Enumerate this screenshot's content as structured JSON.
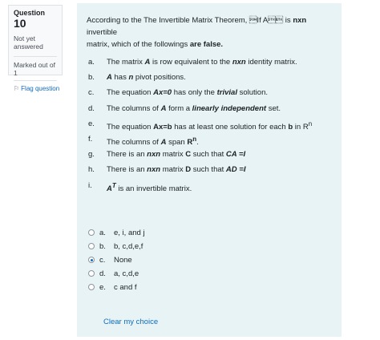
{
  "info": {
    "question_label": "Question",
    "question_number": "10",
    "state": "Not yet answered",
    "grade": "Marked out of 1",
    "flag_label": "Flag question",
    "flag_icon": "flag-icon"
  },
  "question": {
    "line1": "According to the The Invertible Matrix Theorem, If A is nxn invertible",
    "line2": "matrix, which of the followings are false."
  },
  "statements": [
    {
      "label": "a.",
      "text": "The matrix A is row equivalent to the nxn identity matrix."
    },
    {
      "label": "b.",
      "text": "A has n pivot positions."
    },
    {
      "label": "c.",
      "text": "The equation Ax=0 has only the trivial solution."
    },
    {
      "label": "d.",
      "text": "The columns of A form a linearly independent set."
    },
    {
      "label": "e.",
      "text": "The equation Ax=b has at least one solution for each b in Rⁿ"
    },
    {
      "label": "f.",
      "text": "The columns of A span Rⁿ."
    },
    {
      "label": "g.",
      "text": "There is an nxn matrix C such that CA =I"
    },
    {
      "label": "h.",
      "text": "There is an nxn matrix D such that AD =I"
    },
    {
      "label": "i.",
      "text": "Aᵀ is an invertible matrix."
    }
  ],
  "options": [
    {
      "label": "a.",
      "text": "e, i, and j",
      "checked": false
    },
    {
      "label": "b.",
      "text": "b, c,d,e,f",
      "checked": false
    },
    {
      "label": "c.",
      "text": "None",
      "checked": true
    },
    {
      "label": "d.",
      "text": "a, c,d,e",
      "checked": false
    },
    {
      "label": "e.",
      "text": "c and f",
      "checked": false
    }
  ],
  "clear_label": "Clear my choice",
  "colors": {
    "accent": "#0f6cbf",
    "panel": "#e7f3f5"
  }
}
